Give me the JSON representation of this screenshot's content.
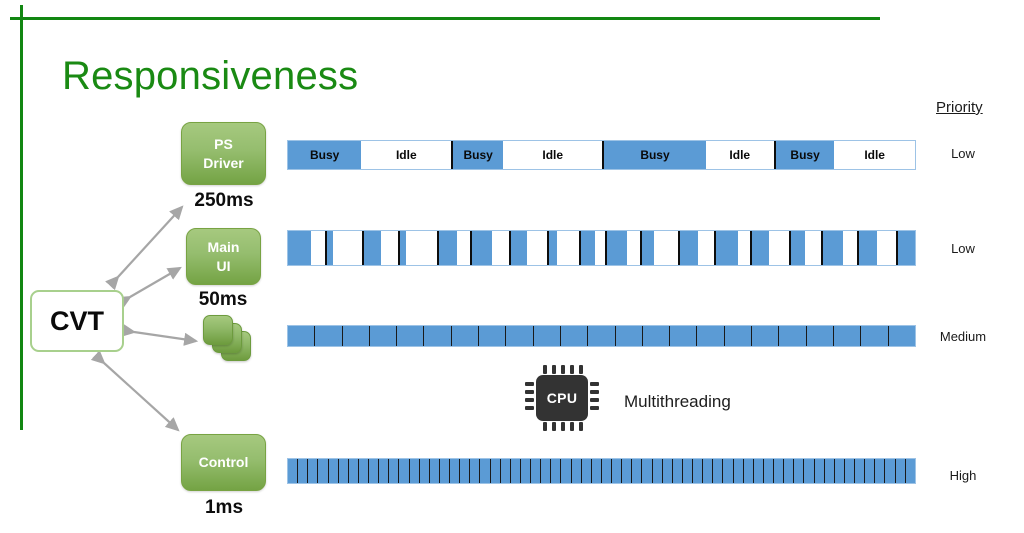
{
  "slide": {
    "title": "Responsiveness",
    "hub_label": "CVT"
  },
  "tasks": [
    {
      "name": "PS Driver",
      "line1": "PS",
      "line2": "Driver",
      "period": "250ms"
    },
    {
      "name": "Main UI",
      "line1": "Main",
      "line2": "UI",
      "period": "50ms"
    },
    {
      "name": "Worker Threads",
      "line1": "",
      "line2": "",
      "period": ""
    },
    {
      "name": "Control",
      "line1": "Control",
      "line2": "",
      "period": "1ms"
    }
  ],
  "priority": {
    "header": "Priority",
    "values": [
      "Low",
      "Low",
      "Medium",
      "High"
    ]
  },
  "cpu": {
    "chip_label": "CPU",
    "caption": "Multithreading"
  },
  "labels": {
    "busy": "Busy",
    "idle": "Idle"
  },
  "colors": {
    "accent_green": "#128712",
    "title_green": "#1a8a13",
    "box_green_light": "#a6c97f",
    "box_green_dark": "#74a344",
    "busy_blue": "#5b9bd5",
    "bar_border": "#9dc3e6",
    "divider_black": "#0d0d0d",
    "arrow_gray": "#a6a6a6",
    "cpu_dark": "#333333"
  },
  "chart_data": {
    "type": "timeline",
    "title": "Responsiveness",
    "row_label_field": "task",
    "rows": [
      {
        "task": "PS Driver",
        "period_ms": 250,
        "priority": "Low",
        "segments": [
          {
            "state": "Busy",
            "label": "Busy",
            "width_pct": 11.8
          },
          {
            "state": "Idle",
            "label": "Idle",
            "width_pct": 14.5
          },
          {
            "state": "Busy",
            "label": "Busy",
            "width_pct": 8.0
          },
          {
            "state": "Idle",
            "label": "Idle",
            "width_pct": 16.0
          },
          {
            "state": "Busy",
            "label": "Busy",
            "width_pct": 16.3
          },
          {
            "state": "Idle",
            "label": "Idle",
            "width_pct": 11.0
          },
          {
            "state": "Busy",
            "label": "Busy",
            "width_pct": 9.4
          },
          {
            "state": "Idle",
            "label": "Idle",
            "width_pct": 13.0
          }
        ]
      },
      {
        "task": "Main UI",
        "period_ms": 50,
        "priority": "Low",
        "segments": [
          {
            "state": "Busy",
            "width_pct": 3.6
          },
          {
            "state": "Idle",
            "width_pct": 2.1
          },
          {
            "state": "Busy",
            "width_pct": 1.0
          },
          {
            "state": "Idle",
            "width_pct": 4.5
          },
          {
            "state": "Busy",
            "width_pct": 2.6
          },
          {
            "state": "Idle",
            "width_pct": 2.6
          },
          {
            "state": "Busy",
            "width_pct": 1.0
          },
          {
            "state": "Idle",
            "width_pct": 4.8
          },
          {
            "state": "Busy",
            "width_pct": 2.8
          },
          {
            "state": "Idle",
            "width_pct": 2.0
          },
          {
            "state": "Busy",
            "width_pct": 3.2
          },
          {
            "state": "Idle",
            "width_pct": 2.5
          },
          {
            "state": "Busy",
            "width_pct": 2.6
          },
          {
            "state": "Idle",
            "width_pct": 3.0
          },
          {
            "state": "Busy",
            "width_pct": 1.3
          },
          {
            "state": "Idle",
            "width_pct": 3.4
          },
          {
            "state": "Busy",
            "width_pct": 2.2
          },
          {
            "state": "Idle",
            "width_pct": 1.6
          },
          {
            "state": "Busy",
            "width_pct": 3.0
          },
          {
            "state": "Idle",
            "width_pct": 2.1
          },
          {
            "state": "Busy",
            "width_pct": 1.9
          },
          {
            "state": "Idle",
            "width_pct": 3.6
          },
          {
            "state": "Busy",
            "width_pct": 2.9
          },
          {
            "state": "Idle",
            "width_pct": 2.4
          },
          {
            "state": "Busy",
            "width_pct": 3.4
          },
          {
            "state": "Idle",
            "width_pct": 2.0
          },
          {
            "state": "Busy",
            "width_pct": 2.6
          },
          {
            "state": "Idle",
            "width_pct": 3.1
          },
          {
            "state": "Busy",
            "width_pct": 2.1
          },
          {
            "state": "Idle",
            "width_pct": 2.6
          },
          {
            "state": "Busy",
            "width_pct": 3.1
          },
          {
            "state": "Idle",
            "width_pct": 2.2
          },
          {
            "state": "Busy",
            "width_pct": 2.7
          },
          {
            "state": "Idle",
            "width_pct": 3.0
          },
          {
            "state": "Busy",
            "width_pct": 2.6
          }
        ]
      },
      {
        "task": "Worker Threads",
        "period_ms": null,
        "priority": "Medium",
        "all_busy": true,
        "segment_count": 23
      },
      {
        "task": "Control",
        "period_ms": 1,
        "priority": "High",
        "all_busy": true,
        "segment_count": 62
      }
    ]
  }
}
